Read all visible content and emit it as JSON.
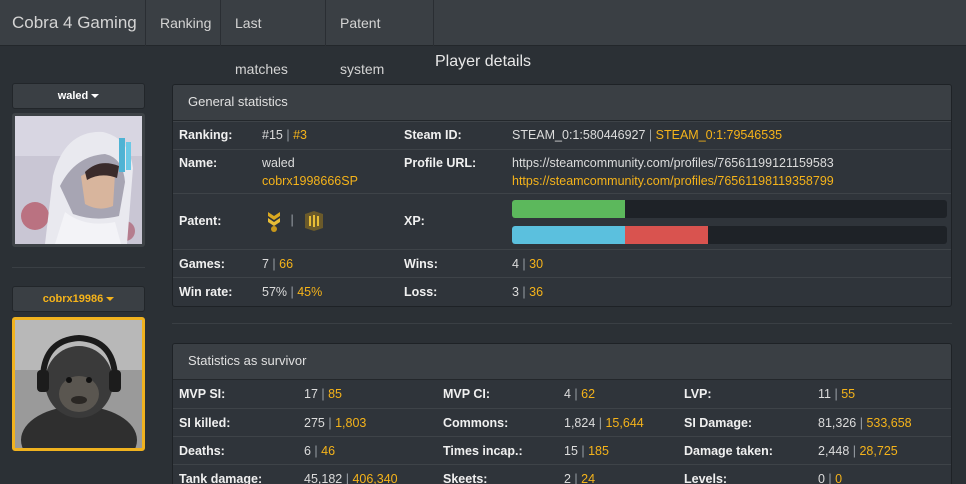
{
  "nav": {
    "brand": "Cobra 4 Gaming",
    "items": [
      "Ranking",
      "Last matches",
      "Patent system"
    ]
  },
  "page_title": "Player details",
  "players": [
    {
      "name": "waled",
      "highlight": false
    },
    {
      "name": "cobrx19986",
      "highlight": true
    }
  ],
  "general": {
    "title": "General statistics",
    "ranking": {
      "label": "Ranking:",
      "p1": "#15",
      "p2": "#3"
    },
    "steam_id": {
      "label": "Steam ID:",
      "p1": "STEAM_0:1:580446927",
      "p2": "STEAM_0:1:79546535"
    },
    "name": {
      "label": "Name:",
      "p1": "waled",
      "p2": "cobrx1998666SP"
    },
    "profile_url": {
      "label": "Profile URL:",
      "p1": "https://steamcommunity.com/profiles/76561199121159583",
      "p2": "https://steamcommunity.com/profiles/76561198119358799"
    },
    "patent": {
      "label": "Patent:",
      "p1_icon": "chevron-rank-icon",
      "p2_icon": "bars-rank-icon"
    },
    "xp": {
      "label": "XP:",
      "p1_fraction": 0.26,
      "p2_fraction_a": 0.26,
      "p2_fraction_b": 0.19
    },
    "games": {
      "label": "Games:",
      "p1": "7",
      "p2": "66"
    },
    "wins": {
      "label": "Wins:",
      "p1": "4",
      "p2": "30"
    },
    "win_rate": {
      "label": "Win rate:",
      "p1": "57%",
      "p2": "45%"
    },
    "loss": {
      "label": "Loss:",
      "p1": "3",
      "p2": "36"
    }
  },
  "survivor": {
    "title": "Statistics as survivor",
    "rows": [
      [
        {
          "label": "MVP SI:",
          "p1": "17",
          "p2": "85"
        },
        {
          "label": "MVP CI:",
          "p1": "4",
          "p2": "62"
        },
        {
          "label": "LVP:",
          "p1": "11",
          "p2": "55"
        }
      ],
      [
        {
          "label": "SI killed:",
          "p1": "275",
          "p2": "1,803"
        },
        {
          "label": "Commons:",
          "p1": "1,824",
          "p2": "15,644"
        },
        {
          "label": "SI Damage:",
          "p1": "81,326",
          "p2": "533,658"
        }
      ],
      [
        {
          "label": "Deaths:",
          "p1": "6",
          "p2": "46"
        },
        {
          "label": "Times incap.:",
          "p1": "15",
          "p2": "185"
        },
        {
          "label": "Damage taken:",
          "p1": "2,448",
          "p2": "28,725"
        }
      ],
      [
        {
          "label": "Tank damage:",
          "p1": "45,182",
          "p2": "406,340"
        },
        {
          "label": "Skeets:",
          "p1": "2",
          "p2": "24"
        },
        {
          "label": "Levels:",
          "p1": "0",
          "p2": "0"
        }
      ]
    ]
  },
  "colors": {
    "accent": "#f5b31a",
    "xp_green": "#5cb85c",
    "xp_blue": "#5bc0de",
    "xp_red": "#d9534f"
  }
}
